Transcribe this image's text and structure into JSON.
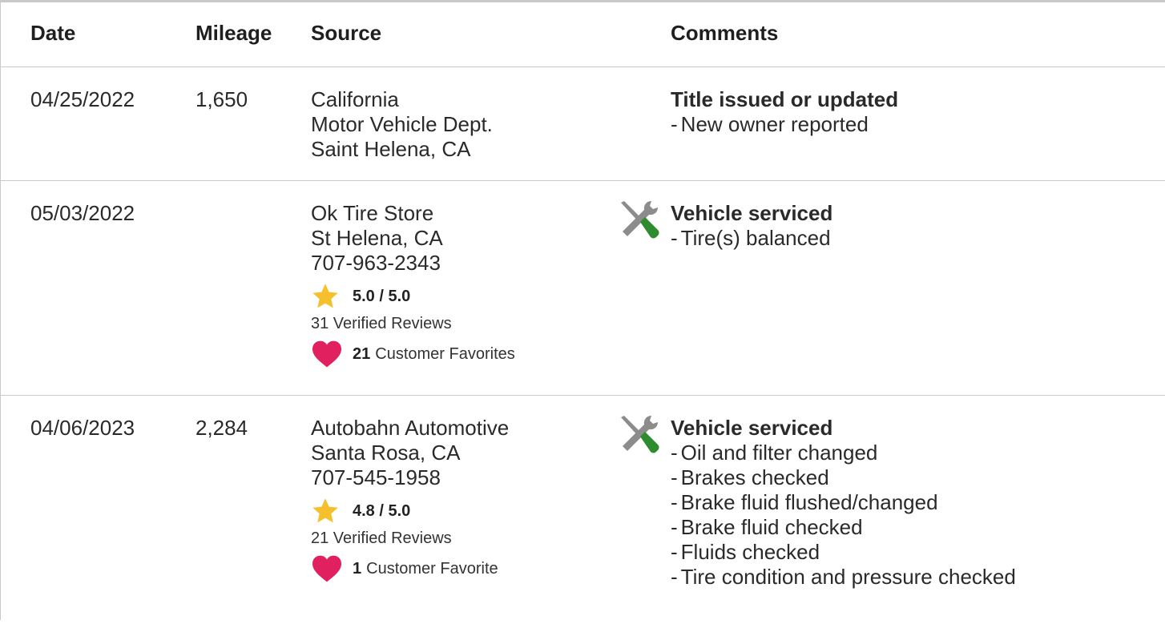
{
  "headers": {
    "date": "Date",
    "mileage": "Mileage",
    "source": "Source",
    "comments": "Comments"
  },
  "records": [
    {
      "date": "04/25/2022",
      "mileage": "1,650",
      "source_lines": [
        "California",
        "Motor Vehicle Dept.",
        "Saint Helena, CA"
      ],
      "comment_title": "Title issued or updated",
      "comment_items": [
        "New owner reported"
      ]
    },
    {
      "date": "05/03/2022",
      "mileage": "",
      "source_lines": [
        "Ok Tire Store",
        "St Helena, CA",
        "707-963-2343"
      ],
      "rating": "5.0 / 5.0",
      "reviews": "31 Verified Reviews",
      "favorites_count": "21",
      "favorites_label": "Customer Favorites",
      "icon": "service-tools-icon",
      "comment_title": "Vehicle serviced",
      "comment_items": [
        "Tire(s) balanced"
      ]
    },
    {
      "date": "04/06/2023",
      "mileage": "2,284",
      "source_lines": [
        "Autobahn Automotive",
        "Santa Rosa, CA",
        "707-545-1958"
      ],
      "rating": "4.8 / 5.0",
      "reviews": "21 Verified Reviews",
      "favorites_count": "1",
      "favorites_label": "Customer Favorite",
      "icon": "service-tools-icon",
      "comment_title": "Vehicle serviced",
      "comment_items": [
        "Oil and filter changed",
        "Brakes checked",
        "Brake fluid flushed/changed",
        "Brake fluid checked",
        "Fluids checked",
        "Tire condition and pressure checked"
      ]
    }
  ],
  "colors": {
    "star": "#f6c02c",
    "heart": "#e0205f",
    "tool_gray": "#8c8c8c",
    "tool_green": "#2e8b2e",
    "divider": "#c9c9c9"
  }
}
